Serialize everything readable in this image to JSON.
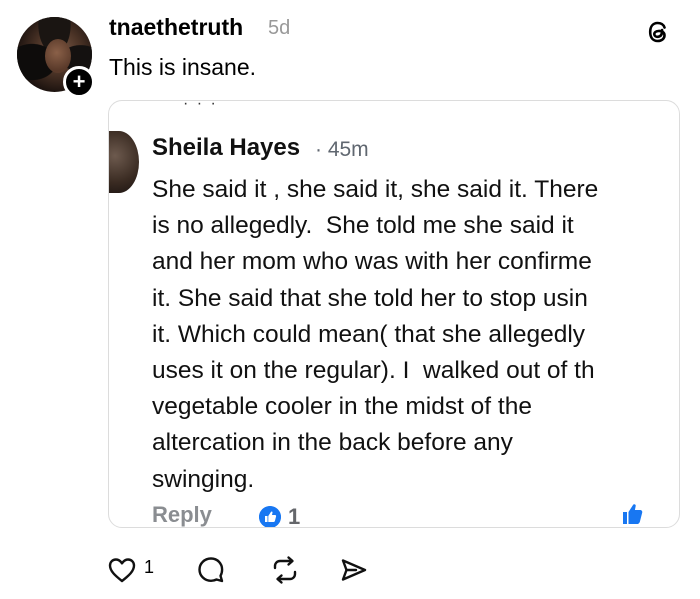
{
  "post": {
    "username": "tnaethetruth",
    "time_ago": "5d",
    "text": "This is insane.",
    "follow_symbol": "+",
    "likes": "1"
  },
  "embedded": {
    "name": "Sheila Hayes",
    "time": "· 45m",
    "lines": [
      "She said it , she said it, she said it. There",
      "is no allegedly.  She told me she said it",
      "and her mom who was with her confirme",
      "it. She said that she told her to stop usin",
      "it. Which could mean( that she allegedly",
      "uses it on the regular). I  walked out of th",
      "vegetable cooler in the midst of the",
      "altercation in the back before any",
      "swinging."
    ],
    "reply_label": "Reply",
    "like_count": "1"
  },
  "colors": {
    "fb_blue": "#1877f2",
    "muted": "#999999"
  },
  "icons": [
    "threads-logo-icon",
    "heart-icon",
    "comment-icon",
    "repost-icon",
    "share-icon",
    "like-thumb-icon"
  ]
}
